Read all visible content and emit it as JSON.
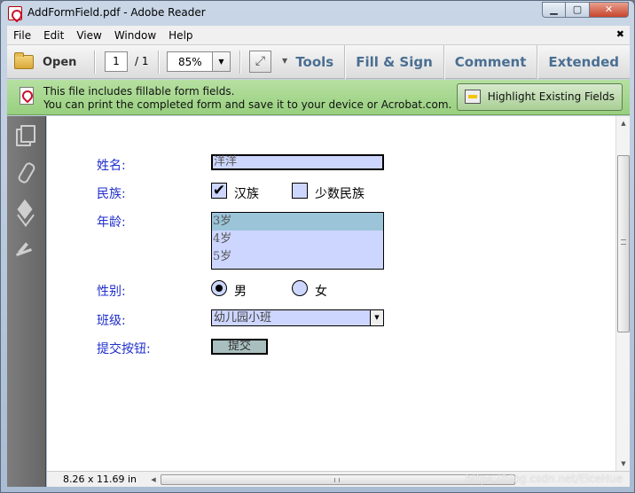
{
  "window": {
    "title": "AddFormField.pdf - Adobe Reader",
    "min_glyph": "▁",
    "max_glyph": "▢",
    "close_glyph": "✕"
  },
  "menu": {
    "items": [
      "File",
      "Edit",
      "View",
      "Window",
      "Help"
    ],
    "close_glyph": "✖"
  },
  "toolbar": {
    "open_label": "Open",
    "page_current": "1",
    "page_total": "/ 1",
    "zoom": "85%",
    "tabs": [
      "Tools",
      "Fill & Sign",
      "Comment",
      "Extended"
    ]
  },
  "notice": {
    "line1": "This file includes fillable form fields.",
    "line2": "You can print the completed form and save it to your device or Acrobat.com.",
    "highlight_label": "Highlight Existing Fields"
  },
  "form": {
    "name_label": "姓名:",
    "name_value": "洋洋",
    "ethnic_label": "民族:",
    "ethnic_option1": "汉族",
    "ethnic_option2": "少数民族",
    "ethnic_option1_checked": true,
    "ethnic_check_glyph": "✔",
    "age_label": "年龄:",
    "age_options": [
      "3岁",
      "4岁",
      "5岁"
    ],
    "age_selected_index": 0,
    "gender_label": "性别:",
    "gender_option1": "男",
    "gender_option2": "女",
    "class_label": "班级:",
    "class_value": "幼儿园小班",
    "submit_label": "提交按钮:",
    "submit_button": "提交"
  },
  "status": {
    "page_size": "8.26 x 11.69 in",
    "watermark": "https://blog.csdn.net/EiceHue"
  },
  "colors": {
    "form_label": "#1f2ecc",
    "field_fill": "#cdd6ff",
    "notice_bg": "#a7d890"
  }
}
